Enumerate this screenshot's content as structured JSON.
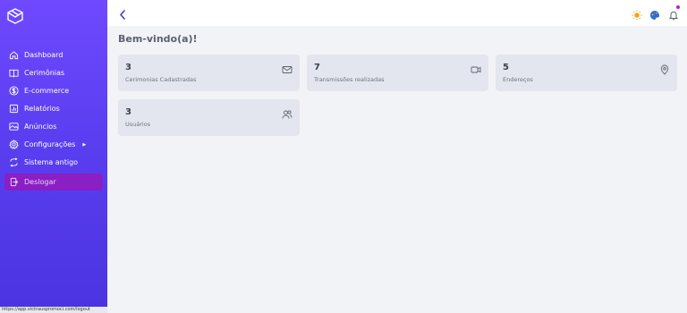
{
  "sidebar": {
    "items": [
      {
        "label": "Dashboard",
        "icon": "home-icon"
      },
      {
        "label": "Cerimônias",
        "icon": "book-icon"
      },
      {
        "label": "E-commerce",
        "icon": "dollar-icon"
      },
      {
        "label": "Relatórios",
        "icon": "report-icon"
      },
      {
        "label": "Anúncios",
        "icon": "image-icon"
      },
      {
        "label": "Configurações",
        "icon": "gear-icon"
      },
      {
        "label": "Sistema antigo",
        "icon": "switch-icon"
      },
      {
        "label": "Deslogar",
        "icon": "logout-icon"
      }
    ]
  },
  "status_bar": {
    "url": "https://app.victrauspromoci.com/logout"
  },
  "header": {
    "title": "Bem-vindo(a)!"
  },
  "cards": [
    {
      "value": "3",
      "label": "Cerimonias Cadastradas",
      "icon": "mail-icon"
    },
    {
      "value": "7",
      "label": "Transmissões realizadas",
      "icon": "video-icon"
    },
    {
      "value": "5",
      "label": "Endereços",
      "icon": "map-pin-icon"
    },
    {
      "value": "3",
      "label": "Usuários",
      "icon": "users-icon"
    }
  ],
  "colors": {
    "sidebar_top": "#6f49ff",
    "sidebar_bottom": "#4b34e0",
    "logout_bg": "#8a1fc4",
    "card_bg": "#e3e6ee",
    "notification": "#c21fc8"
  }
}
